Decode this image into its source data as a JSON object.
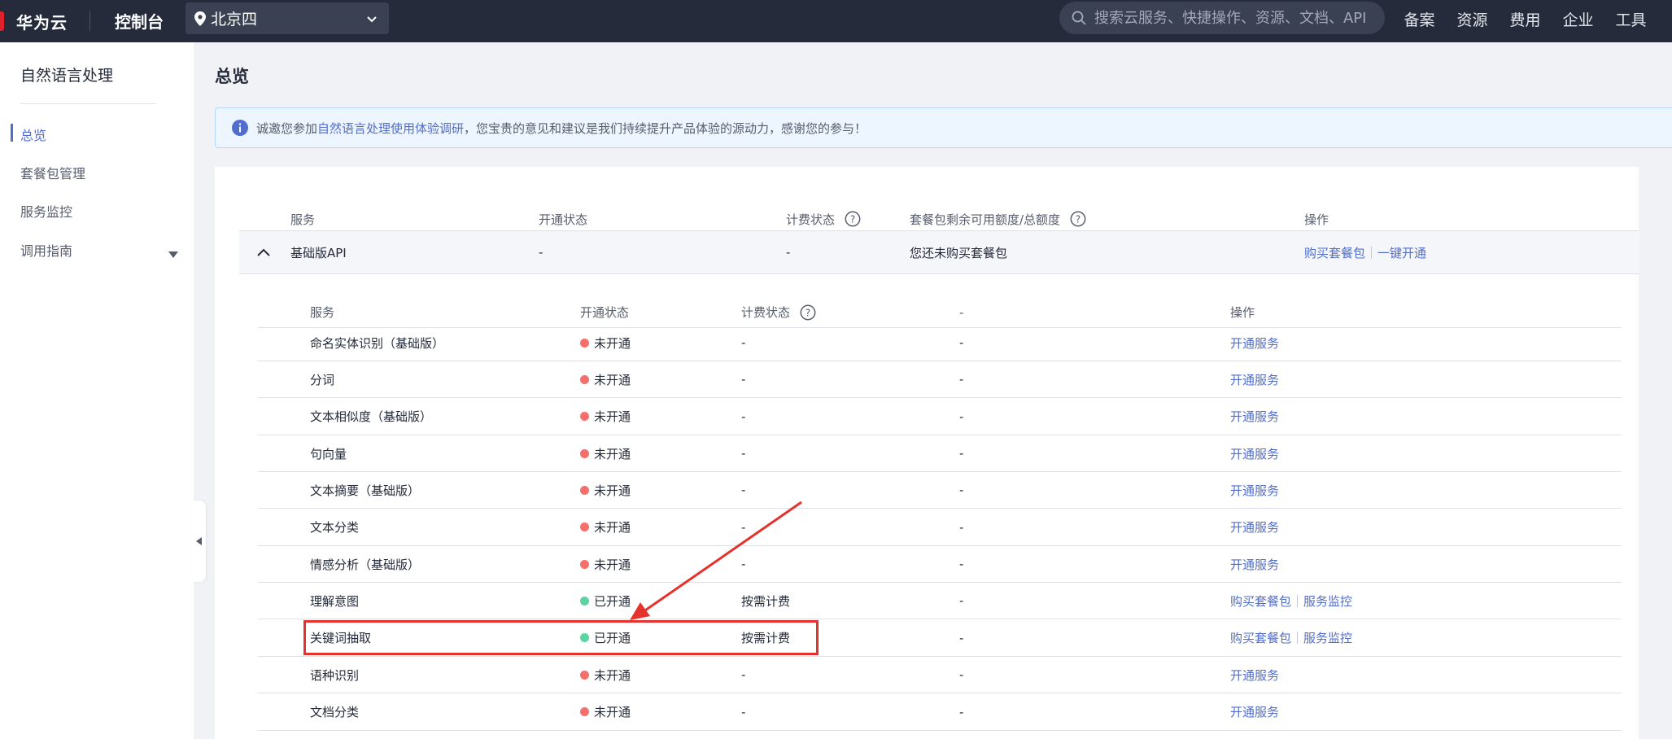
{
  "topbar": {
    "brand": "华为云",
    "console": "控制台",
    "region": "北京四",
    "search_placeholder": "搜索云服务、快捷操作、资源、文档、API",
    "nav": [
      "备案",
      "资源",
      "费用",
      "企业",
      "工具"
    ]
  },
  "sidebar": {
    "title": "自然语言处理",
    "items": [
      {
        "label": "总览"
      },
      {
        "label": "套餐包管理"
      },
      {
        "label": "服务监控"
      },
      {
        "label": "调用指南"
      }
    ]
  },
  "page": {
    "title": "总览",
    "notice": {
      "prefix": "诚邀您参加",
      "link": "自然语言处理使用体验调研",
      "suffix": "，您宝贵的意见和建议是我们持续提升产品体验的源动力，感谢您的参与！"
    }
  },
  "outer_table": {
    "headers": {
      "service": "服务",
      "status": "开通状态",
      "billing": "计费状态",
      "quota": "套餐包剩余可用额度/总额度",
      "actions": "操作"
    },
    "row": {
      "service": "基础版API",
      "status": "-",
      "billing": "-",
      "quota": "您还未购买套餐包",
      "action_buy": "购买套餐包",
      "action_enable": "一键开通"
    }
  },
  "inner_table": {
    "headers": {
      "service": "服务",
      "status": "开通状态",
      "billing": "计费状态",
      "quota": "-",
      "actions": "操作"
    },
    "rows": [
      {
        "service": "命名实体识别（基础版）",
        "status": "未开通",
        "billing": "-",
        "quota": "-",
        "actions": [
          "开通服务"
        ]
      },
      {
        "service": "分词",
        "status": "未开通",
        "billing": "-",
        "quota": "-",
        "actions": [
          "开通服务"
        ]
      },
      {
        "service": "文本相似度（基础版）",
        "status": "未开通",
        "billing": "-",
        "quota": "-",
        "actions": [
          "开通服务"
        ]
      },
      {
        "service": "句向量",
        "status": "未开通",
        "billing": "-",
        "quota": "-",
        "actions": [
          "开通服务"
        ]
      },
      {
        "service": "文本摘要（基础版）",
        "status": "未开通",
        "billing": "-",
        "quota": "-",
        "actions": [
          "开通服务"
        ]
      },
      {
        "service": "文本分类",
        "status": "未开通",
        "billing": "-",
        "quota": "-",
        "actions": [
          "开通服务"
        ]
      },
      {
        "service": "情感分析（基础版）",
        "status": "未开通",
        "billing": "-",
        "quota": "-",
        "actions": [
          "开通服务"
        ]
      },
      {
        "service": "理解意图",
        "status": "已开通",
        "billing": "按需计费",
        "quota": "-",
        "actions": [
          "购买套餐包",
          "服务监控"
        ]
      },
      {
        "service": "关键词抽取",
        "status": "已开通",
        "billing": "按需计费",
        "quota": "-",
        "actions": [
          "购买套餐包",
          "服务监控"
        ]
      },
      {
        "service": "语种识别",
        "status": "未开通",
        "billing": "-",
        "quota": "-",
        "actions": [
          "开通服务"
        ]
      },
      {
        "service": "文档分类",
        "status": "未开通",
        "billing": "-",
        "quota": "-",
        "actions": [
          "开通服务"
        ]
      }
    ]
  },
  "colors": {
    "accent": "#526ecc",
    "status_off": "#f66f6a",
    "status_on": "#5dd4a0",
    "annotation": "#e5322d"
  }
}
